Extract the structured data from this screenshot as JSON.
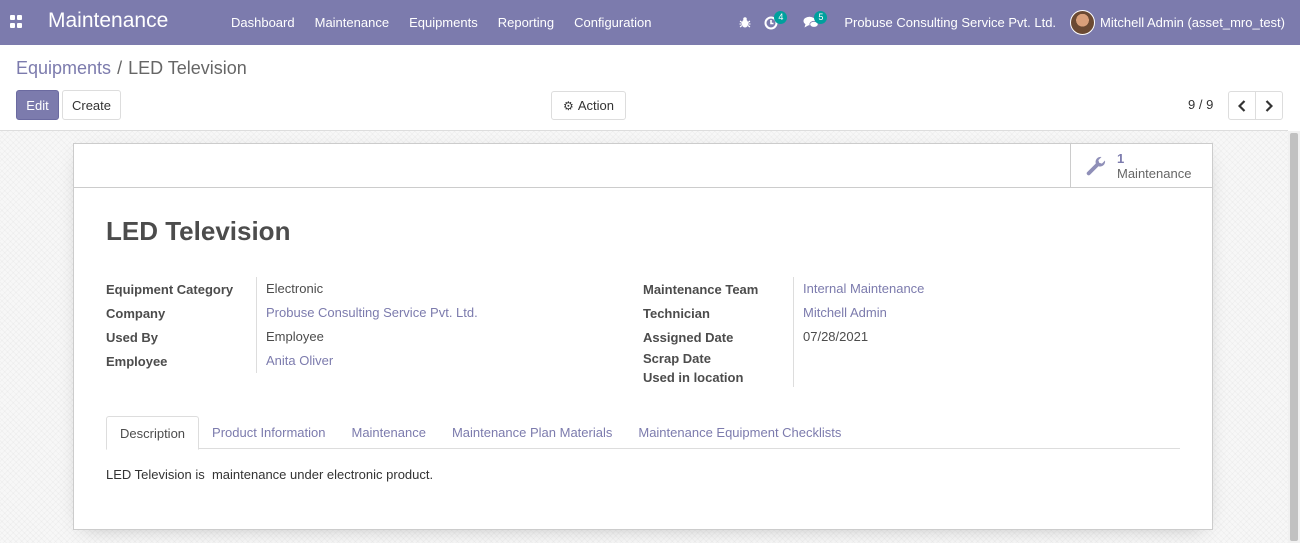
{
  "navbar": {
    "app_title": "Maintenance",
    "menu": [
      "Dashboard",
      "Maintenance",
      "Equipments",
      "Reporting",
      "Configuration"
    ],
    "activity_count": "4",
    "message_count": "5",
    "company": "Probuse Consulting Service Pvt. Ltd.",
    "user": "Mitchell Admin (asset_mro_test)"
  },
  "breadcrumb": {
    "parent": "Equipments",
    "separator": "/",
    "current": "LED Television"
  },
  "buttons": {
    "edit": "Edit",
    "create": "Create",
    "action": "Action"
  },
  "pager": {
    "value": "9 / 9"
  },
  "smart_button": {
    "value": "1",
    "label": "Maintenance"
  },
  "record": {
    "title": "LED Television"
  },
  "fields_left": [
    {
      "label": "Equipment Category",
      "value": "Electronic"
    },
    {
      "label": "Company",
      "value": "Probuse Consulting Service Pvt. Ltd."
    },
    {
      "label": "Used By",
      "value": "Employee"
    },
    {
      "label": "Employee",
      "value": "Anita Oliver"
    }
  ],
  "fields_right": [
    {
      "label": "Maintenance Team",
      "value": "Internal Maintenance"
    },
    {
      "label": "Technician",
      "value": "Mitchell Admin"
    },
    {
      "label": "Assigned Date",
      "value": "07/28/2021"
    },
    {
      "label": "Scrap Date",
      "value": ""
    },
    {
      "label": "Used in location",
      "value": ""
    }
  ],
  "tabs": [
    "Description",
    "Product Information",
    "Maintenance",
    "Maintenance Plan Materials",
    "Maintenance Equipment Checklists"
  ],
  "description": "LED Television is  maintenance under electronic product.",
  "colors": {
    "brand": "#7c7bad",
    "badge": "#00a09d"
  }
}
